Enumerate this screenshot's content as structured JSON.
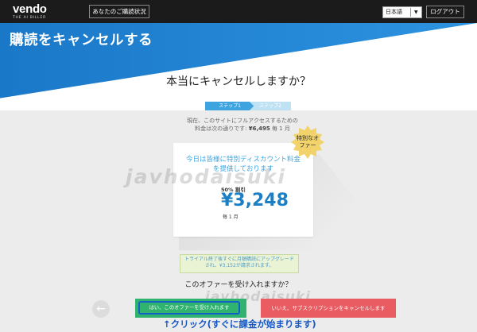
{
  "header": {
    "logo": "vendo",
    "logo_sub": "THE AI BILLER",
    "status_button": "あなたのご購読状況",
    "language": "日本語",
    "logout_button": "ログアウト"
  },
  "hero": {
    "title": "購読をキャンセルする",
    "question": "本当にキャンセルしますか？"
  },
  "steps": {
    "step1": "ステップ1",
    "step2": "ステップ2"
  },
  "access": {
    "line1": "現在、このサイトにフルアクセスするための",
    "line2_prefix": "料金は次の通りです: ",
    "line2_price": "¥6,495",
    "line2_suffix": " 毎 1 月"
  },
  "offer": {
    "headline_1": "今日は皆様に特別ディスカウント料金",
    "headline_2": "を提供しております",
    "discount": "50% 割引",
    "price": "¥3,248",
    "per": "毎 1 月",
    "badge_1": "特別なオ",
    "badge_2": "ファー"
  },
  "note": {
    "text": "トライアル終了後すぐに月額購読にアップグレードされ、¥3,152が請求されます。"
  },
  "accept_question": "このオファーを受け入れますか？",
  "buttons": {
    "accept": "はい、このオファーを受け入れます",
    "cancel": "いいえ、サブスクリプションをキャンセルします"
  },
  "annotation": "↑クリック(すぐに課金が始まります)",
  "watermark": {
    "main": "javhodaisuki",
    "small": "javhodaisuki"
  },
  "colors": {
    "topbar": "#1b1b1b",
    "hero_blue": "#2d93e0",
    "price_blue": "#1a7fc4",
    "accept_green": "#2fb36f",
    "cancel_red": "#e85c62",
    "badge_yellow": "#f2d36b"
  }
}
